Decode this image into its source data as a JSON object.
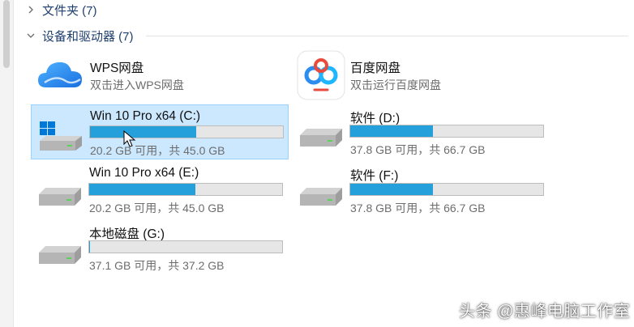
{
  "groups": {
    "folders": {
      "label": "文件夹 (7)"
    },
    "devices": {
      "label": "设备和驱动器 (7)"
    }
  },
  "netdisks": [
    {
      "name": "WPS网盘",
      "subtitle": "双击进入WPS网盘",
      "icon": "wps-cloud-icon"
    },
    {
      "name": "百度网盘",
      "subtitle": "双击运行百度网盘",
      "icon": "baidu-netdisk-icon"
    }
  ],
  "drives": [
    {
      "name": "Win 10 Pro x64 (C:)",
      "space": "20.2 GB 可用，共 45.0 GB",
      "used_fraction": 0.55,
      "windows": true,
      "selected": true
    },
    {
      "name": "软件 (D:)",
      "space": "37.8 GB 可用，共 66.7 GB",
      "used_fraction": 0.43,
      "windows": false,
      "selected": false
    },
    {
      "name": "Win 10 Pro x64 (E:)",
      "space": "20.2 GB 可用，共 45.0 GB",
      "used_fraction": 0.55,
      "windows": false,
      "selected": false
    },
    {
      "name": "软件 (F:)",
      "space": "37.8 GB 可用，共 66.7 GB",
      "used_fraction": 0.43,
      "windows": false,
      "selected": false
    },
    {
      "name": "本地磁盘 (G:)",
      "space": "37.1 GB 可用，共 37.2 GB",
      "used_fraction": 0.003,
      "windows": false,
      "selected": false
    }
  ],
  "colors": {
    "bar_fill": "#26a0da",
    "selection": "#cce8ff",
    "group_text": "#1f3f6e"
  },
  "watermark": "头条 @惠峰电脑工作室"
}
